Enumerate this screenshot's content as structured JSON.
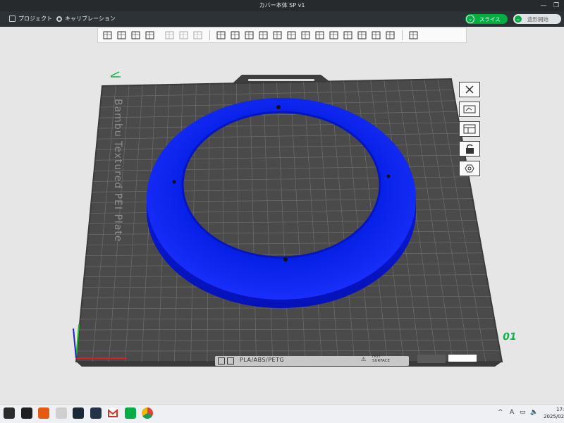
{
  "window": {
    "title": "カバー本体   SP v1"
  },
  "menu": {
    "project_label": "プロジェクト",
    "calibration_label": "キャリブレーション"
  },
  "actions": {
    "slice_label": "スライス",
    "print_label": "造形開始"
  },
  "toolbar": {
    "tools": [
      "add-object-icon",
      "grid-add-icon",
      "arrange-icon",
      "layout-icon",
      "copy-icon",
      "paste-icon",
      "list-icon",
      "move-icon",
      "rotate-icon",
      "scale-icon",
      "lay-on-face-icon",
      "split-icon",
      "cut-icon",
      "support-paint-icon",
      "seam-paint-icon",
      "text-icon",
      "color-paint-icon",
      "measure-icon",
      "assemble-icon",
      "boolean-icon",
      "variable-layer-icon"
    ]
  },
  "side_panel": {
    "tools": [
      "view-close-icon",
      "auto-orient-icon",
      "arrange-plate-icon",
      "lock-icon",
      "plate-settings-icon"
    ]
  },
  "plate": {
    "label": "Bambu Textured PEI Plate",
    "number": "01",
    "material": "PLA/ABS/PETG",
    "surface_line1": "HOT",
    "surface_line2": "SURFACE"
  },
  "model": {
    "color": "#0a1fe8"
  },
  "colors": {
    "accent": "#00ae42",
    "plate": "#4a4a4a",
    "grid": "#6a6a6a"
  },
  "taskbar": {
    "apps": [
      "bambu-studio-icon",
      "file-explorer-icon",
      "orange-app-icon",
      "alien-app-icon",
      "steam-icon",
      "steam-alt-icon",
      "gmail-icon",
      "green-app-icon",
      "chrome-icon"
    ],
    "tray_chevron": "^",
    "ime_label": "A",
    "time": "17:",
    "date": "2025/02/"
  }
}
